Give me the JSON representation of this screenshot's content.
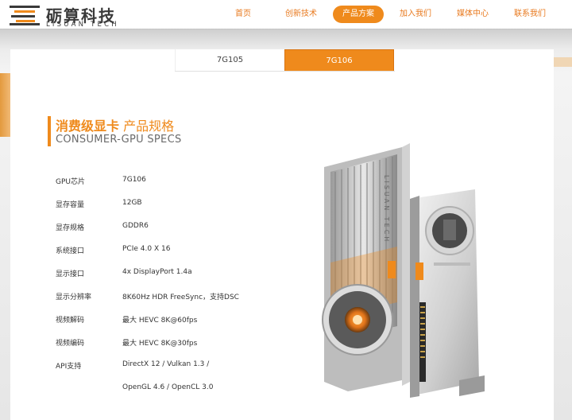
{
  "brand": {
    "name_cn": "砺算科技",
    "name_en": "LISUAN TECH"
  },
  "nav": {
    "items": [
      {
        "label": "首页"
      },
      {
        "label": "创新技术"
      },
      {
        "label": "产品方案",
        "active": true
      },
      {
        "label": "加入我们"
      },
      {
        "label": "媒体中心"
      },
      {
        "label": "联系我们"
      }
    ]
  },
  "tabs": [
    {
      "label": "7G105",
      "active": false
    },
    {
      "label": "7G106",
      "active": true
    }
  ],
  "section": {
    "title_cn_bold": "消费级显卡",
    "title_cn_rest": " 产品规格",
    "title_en": "CONSUMER-GPU SPECS"
  },
  "specs": [
    {
      "label": "GPU芯片",
      "value": "7G106"
    },
    {
      "label": "显存容量",
      "value": "12GB"
    },
    {
      "label": "显存规格",
      "value": "GDDR6"
    },
    {
      "label": "系统接口",
      "value": "PCIe 4.0 X 16"
    },
    {
      "label": "显示接口",
      "value": "4x DisplayPort 1.4a"
    },
    {
      "label": "显示分辨率",
      "value": "8K60Hz HDR FreeSync，支持DSC"
    },
    {
      "label": "视频解码",
      "value": "最大 HEVC 8K@60fps"
    },
    {
      "label": "视频编码",
      "value": "最大 HEVC 8K@30fps"
    },
    {
      "label": "API支持",
      "value": "DirectX 12 / Vulkan 1.3 /"
    },
    {
      "label": "",
      "value": "OpenGL 4.6 / OpenCL 3.0"
    }
  ],
  "product_image_text": "LISUAN TECH",
  "colors": {
    "accent": "#ef8a1c",
    "text": "#333333"
  }
}
